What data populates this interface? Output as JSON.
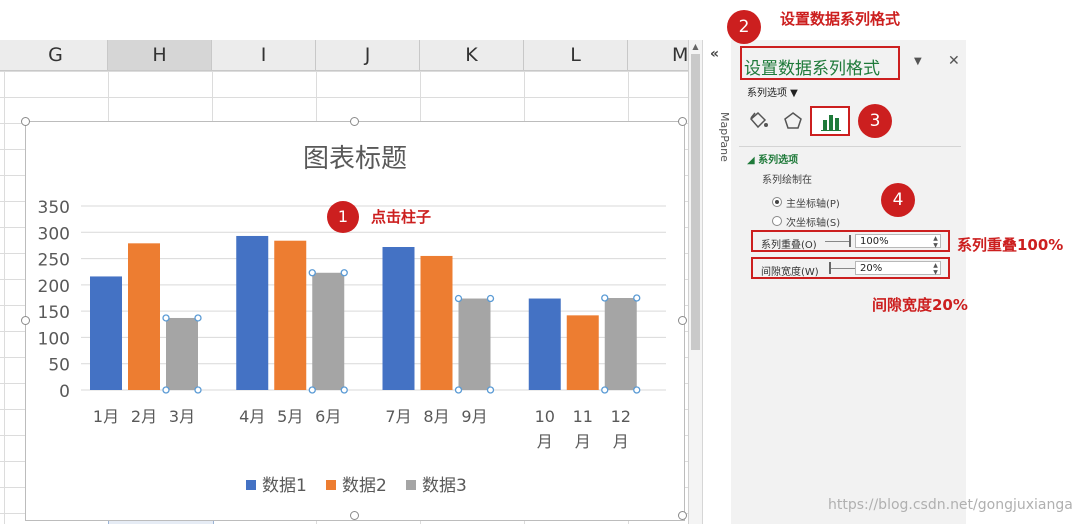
{
  "sheet": {
    "columns": [
      "G",
      "H",
      "I",
      "J",
      "K",
      "L",
      "M"
    ],
    "selected_column": "H"
  },
  "mappane": {
    "collapse_glyph": "«",
    "label": "MapPane"
  },
  "pane": {
    "title": "设置数据系列格式",
    "dropdown_glyph": "▼",
    "close_glyph": "✕",
    "series_options_menu": "系列选项 ▼",
    "section_header": "◢ 系列选项",
    "plot_on_label": "系列绘制在",
    "radio_primary": "主坐标轴(P)",
    "radio_secondary": "次坐标轴(S)",
    "overlap_label": "系列重叠(O)",
    "overlap_value": "100%",
    "gap_label": "间隙宽度(W)",
    "gap_value": "20%",
    "spin_glyph": "▲▼",
    "icons": {
      "fill": "paint-bucket-icon",
      "effects": "pentagon-icon",
      "series": "bar-chart-icon"
    }
  },
  "annotations": {
    "step1": "1",
    "step1_text": "点击柱子",
    "step2": "2",
    "step2_text": "设置数据系列格式",
    "step3": "3",
    "step4": "4",
    "overlap_note": "系列重叠100%",
    "gap_note": "间隙宽度20%",
    "color": "#cc1f1f"
  },
  "watermark": "https://blog.csdn.net/gongjuxianga",
  "chart_data": {
    "type": "bar",
    "title": "图表标题",
    "categories": [
      "1月",
      "2月",
      "3月",
      "4月",
      "5月",
      "6月",
      "7月",
      "8月",
      "9月",
      "10月",
      "11月",
      "12月"
    ],
    "series": [
      {
        "name": "数据1",
        "color": "#4472c4",
        "values": [
          216,
          null,
          null,
          293,
          null,
          null,
          272,
          null,
          null,
          174,
          null,
          null
        ]
      },
      {
        "name": "数据2",
        "color": "#ed7d31",
        "values": [
          null,
          279,
          null,
          null,
          284,
          null,
          null,
          255,
          null,
          null,
          142,
          null
        ]
      },
      {
        "name": "数据3",
        "color": "#a5a5a5",
        "values": [
          null,
          null,
          137,
          null,
          null,
          223,
          null,
          null,
          174,
          null,
          null,
          175
        ]
      }
    ],
    "selected_series": "数据3",
    "ylim": [
      0,
      350
    ],
    "yticks": [
      0,
      50,
      100,
      150,
      200,
      250,
      300,
      350
    ],
    "grid": true,
    "legend": "bottom",
    "xlabel": "",
    "ylabel": ""
  }
}
